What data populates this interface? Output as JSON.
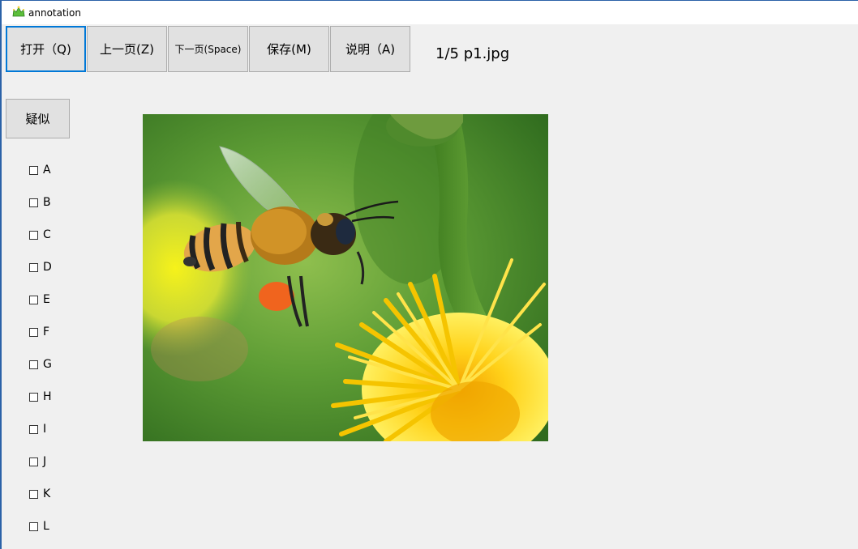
{
  "window": {
    "title": "annotation",
    "icon": "app-crown-icon"
  },
  "toolbar": {
    "open_label": "打开（Q)",
    "prev_label": "上一页(Z)",
    "next_label": "下一页(Space)",
    "save_label": "保存(M)",
    "help_label": "说明（A)"
  },
  "page_info": "1/5 p1.jpg",
  "suspect_label": "疑似",
  "checkboxes": [
    {
      "label": "A",
      "checked": false
    },
    {
      "label": "B",
      "checked": false
    },
    {
      "label": "C",
      "checked": false
    },
    {
      "label": "D",
      "checked": false
    },
    {
      "label": "E",
      "checked": false
    },
    {
      "label": "F",
      "checked": false
    },
    {
      "label": "G",
      "checked": false
    },
    {
      "label": "H",
      "checked": false
    },
    {
      "label": "I",
      "checked": false
    },
    {
      "label": "J",
      "checked": false
    },
    {
      "label": "K",
      "checked": false
    },
    {
      "label": "L",
      "checked": false
    }
  ],
  "colors": {
    "focus_border": "#0078d7",
    "button_bg": "#e1e1e1",
    "window_bg": "#f0f0f0"
  }
}
